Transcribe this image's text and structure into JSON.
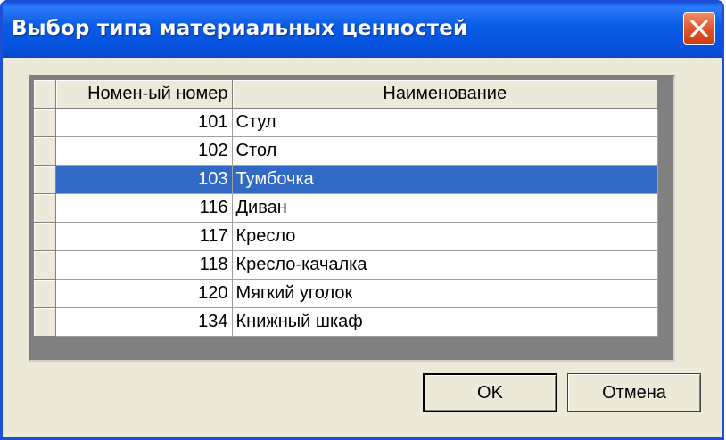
{
  "window": {
    "title": "Выбор типа материальных ценностей",
    "close_icon": "close-icon"
  },
  "colors": {
    "titlebar": "#0450dc",
    "selection": "#316ac5",
    "close_button": "#e2552a",
    "dialog_bg": "#ece9d8"
  },
  "grid": {
    "columns": [
      "Номен-ый номер",
      "Наименование"
    ],
    "rows": [
      {
        "number": "101",
        "name": "Стул"
      },
      {
        "number": "102",
        "name": "Стол"
      },
      {
        "number": "103",
        "name": "Тумбочка"
      },
      {
        "number": "116",
        "name": "Диван"
      },
      {
        "number": "117",
        "name": "Кресло"
      },
      {
        "number": "118",
        "name": "Кресло-качалка"
      },
      {
        "number": "120",
        "name": "Мягкий уголок"
      },
      {
        "number": "134",
        "name": "Книжный шкаф"
      }
    ],
    "selected_number": "103"
  },
  "buttons": {
    "ok_label": "OK",
    "cancel_label": "Отмена"
  }
}
